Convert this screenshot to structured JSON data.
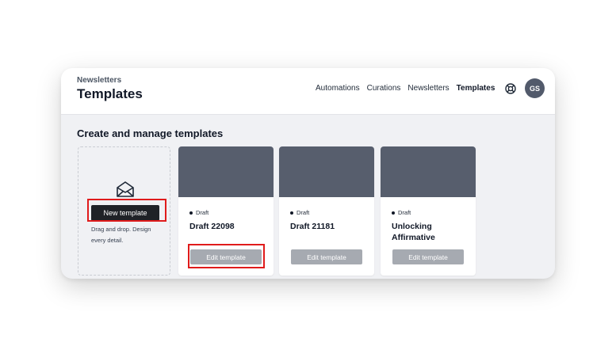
{
  "header": {
    "breadcrumb": "Newsletters",
    "title": "Templates",
    "nav": [
      {
        "label": "Automations",
        "active": false
      },
      {
        "label": "Curations",
        "active": false
      },
      {
        "label": "Newsletters",
        "active": false
      },
      {
        "label": "Templates",
        "active": true
      }
    ],
    "help_icon": "lifebuoy-icon",
    "avatar_initials": "GS"
  },
  "main": {
    "heading": "Create and manage templates",
    "new_card": {
      "icon": "envelope-open-icon",
      "button_label": "New template",
      "description": "Drag and drop. Design every detail."
    },
    "templates": [
      {
        "status": "Draft",
        "name": "Draft 22098",
        "button_label": "Edit template"
      },
      {
        "status": "Draft",
        "name": "Draft 21181",
        "button_label": "Edit template"
      },
      {
        "status": "Draft",
        "name": "Unlocking Affirmative",
        "button_label": "Edit template"
      }
    ]
  },
  "colors": {
    "accent_dark": "#1f2227",
    "thumbnail": "#575e6d",
    "edit_button": "#a6aab1",
    "highlight": "#e01b1b",
    "canvas": "#f0f1f4"
  }
}
